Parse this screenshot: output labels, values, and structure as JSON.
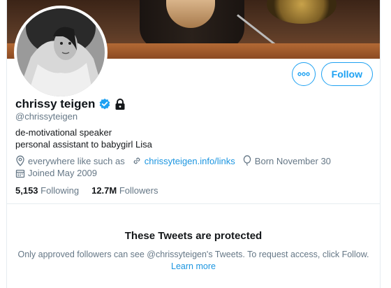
{
  "profile": {
    "name": "chrissy teigen",
    "handle": "@chrissyteigen",
    "bio_lines": [
      "de-motivational speaker",
      "personal assistant to babygirl Lisa"
    ],
    "location": "everywhere like such as",
    "website": "chrissyteigen.info/links",
    "birthday": "Born November 30",
    "joined": "Joined May 2009",
    "following_count": "5,153",
    "following_label": "Following",
    "followers_count": "12.7M",
    "followers_label": "Followers"
  },
  "actions": {
    "follow_label": "Follow",
    "more_icon": "more-dots-icon"
  },
  "protected": {
    "title": "These Tweets are protected",
    "message": "Only approved followers can see @chrissyteigen's Tweets. To request access, click Follow.",
    "learn_more": "Learn more"
  },
  "colors": {
    "accent": "#1da1f2",
    "secondary_text": "#657786",
    "verified": "#1da1f2"
  }
}
